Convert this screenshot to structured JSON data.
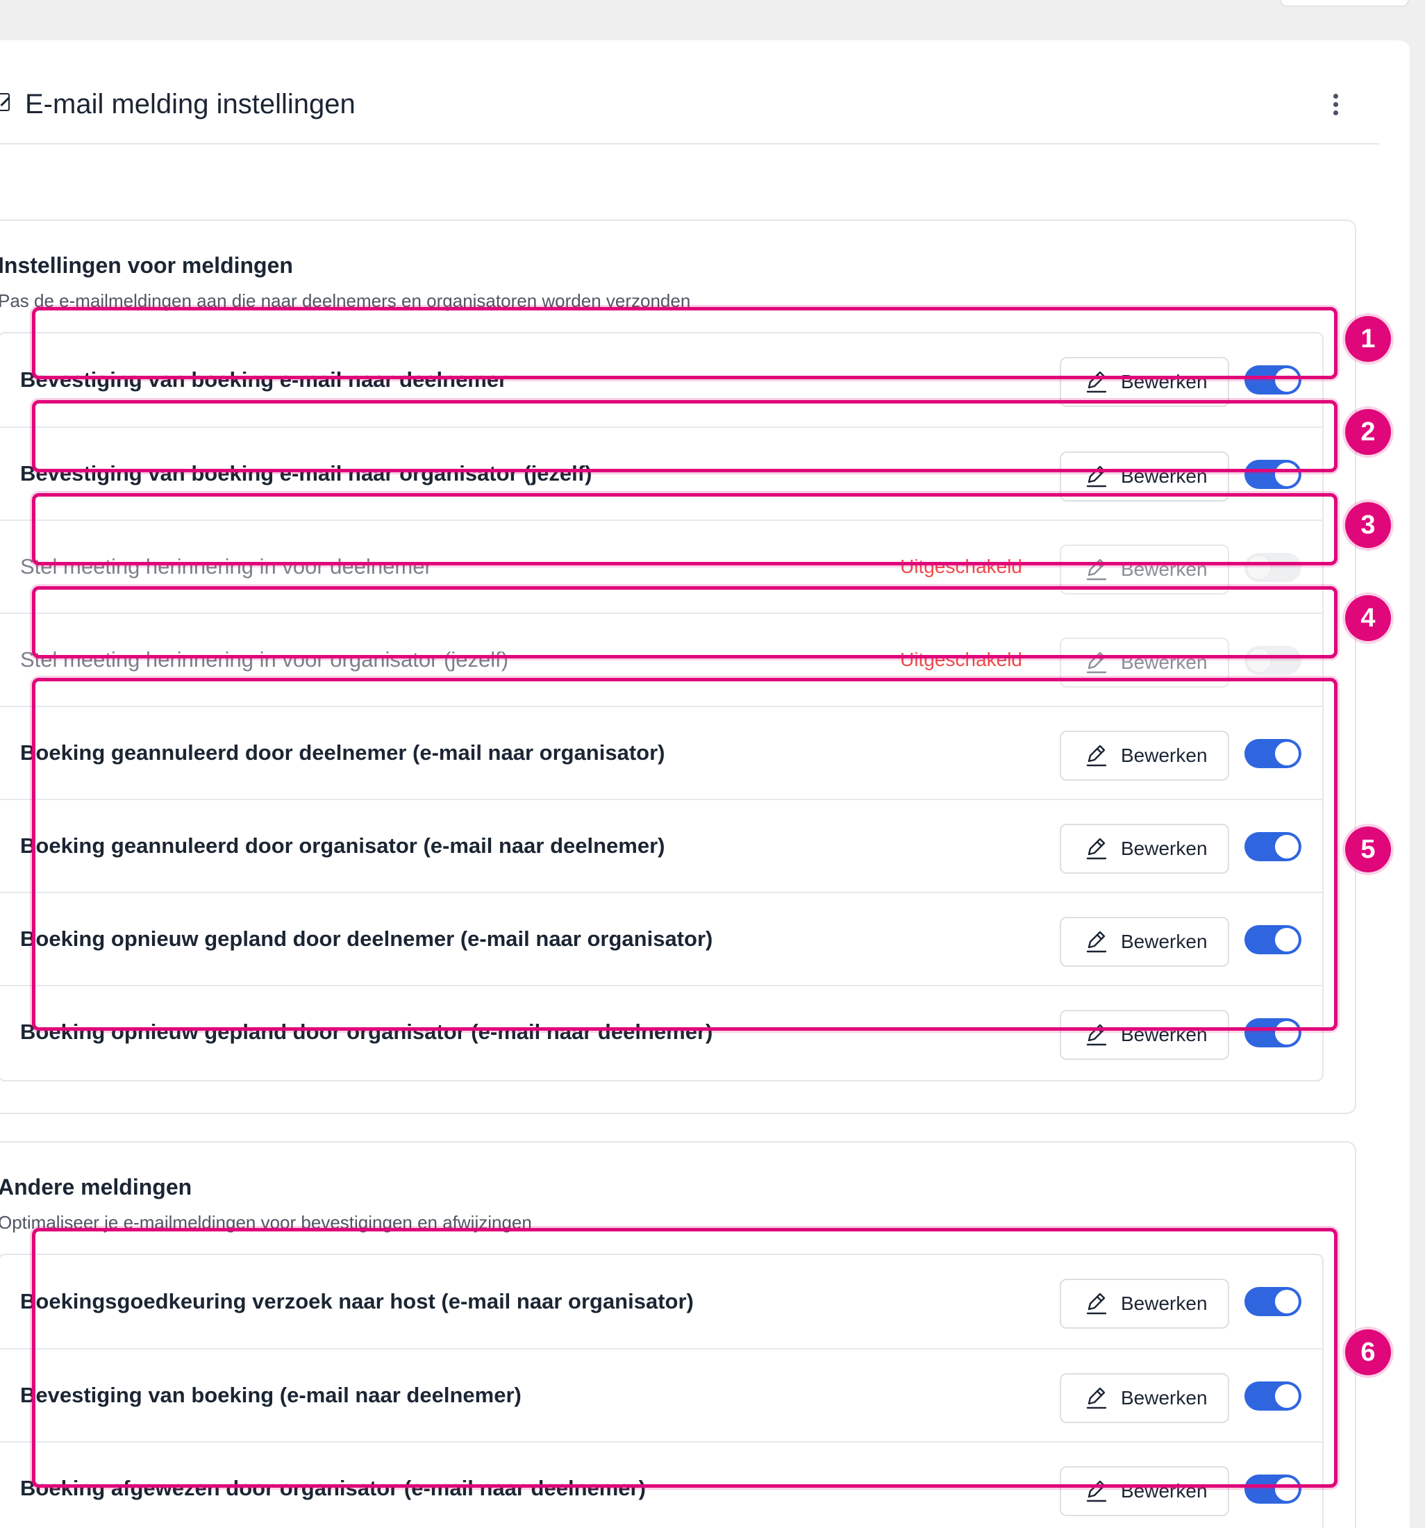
{
  "header": {
    "title": "E-mail melding instellingen",
    "title_icon": "edit-square-icon",
    "menu_icon": "kebab-menu-icon"
  },
  "sections": [
    {
      "title": "Instellingen voor meldingen",
      "subtitle": "Pas de e-mailmeldingen aan die naar deelnemers en organisatoren worden verzonden",
      "rows": [
        {
          "label": "Bevestiging van boeking e-mail naar deelnemer",
          "status": "",
          "edit_label": "Bewerken",
          "enabled": true
        },
        {
          "label": "Bevestiging van boeking e-mail naar organisator (jezelf)",
          "status": "",
          "edit_label": "Bewerken",
          "enabled": true
        },
        {
          "label": "Stel meeting herinnering in voor deelnemer",
          "status": "Uitgeschakeld",
          "edit_label": "Bewerken",
          "enabled": false
        },
        {
          "label": "Stel meeting herinnering in voor organisator (jezelf)",
          "status": "Uitgeschakeld",
          "edit_label": "Bewerken",
          "enabled": false
        },
        {
          "label": "Boeking geannuleerd door deelnemer (e-mail naar organisator)",
          "status": "",
          "edit_label": "Bewerken",
          "enabled": true
        },
        {
          "label": "Boeking geannuleerd door organisator (e-mail naar deelnemer)",
          "status": "",
          "edit_label": "Bewerken",
          "enabled": true
        },
        {
          "label": "Boeking opnieuw gepland door deelnemer (e-mail naar organisator)",
          "status": "",
          "edit_label": "Bewerken",
          "enabled": true
        },
        {
          "label": "Boeking opnieuw gepland door organisator (e-mail naar deelnemer)",
          "status": "",
          "edit_label": "Bewerken",
          "enabled": true
        }
      ]
    },
    {
      "title": "Andere meldingen",
      "subtitle": "Optimaliseer je e-mailmeldingen voor bevestigingen en afwijzingen",
      "rows": [
        {
          "label": "Boekingsgoedkeuring verzoek naar host (e-mail naar organisator)",
          "status": "",
          "edit_label": "Bewerken",
          "enabled": true
        },
        {
          "label": "Bevestiging van boeking (e-mail naar deelnemer)",
          "status": "",
          "edit_label": "Bewerken",
          "enabled": true
        },
        {
          "label": "Boeking afgewezen door organisator (e-mail naar deelnemer)",
          "status": "",
          "edit_label": "Bewerken",
          "enabled": true
        }
      ]
    }
  ],
  "annotations": [
    "1",
    "2",
    "3",
    "4",
    "5",
    "6"
  ],
  "colors": {
    "toggle_on": "#2f66e0",
    "highlight": "#e0077a",
    "disabled_status": "#ee4b4b"
  }
}
